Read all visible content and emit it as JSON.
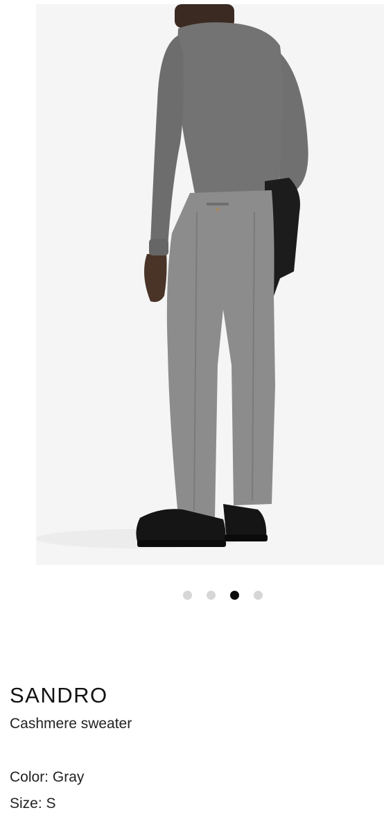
{
  "gallery": {
    "image_alt": "Model wearing gray cashmere sweater and gray trousers, rear view",
    "slide_count": 4,
    "active_index": 2
  },
  "product": {
    "brand": "SANDRO",
    "name": "Cashmere sweater",
    "color_label": "Color:",
    "color_value": "Gray",
    "size_label": "Size:",
    "size_value": "S"
  },
  "colors": {
    "dot_inactive": "#d6d6d6",
    "dot_active": "#0a0a0a",
    "image_background": "#f5f5f5"
  }
}
